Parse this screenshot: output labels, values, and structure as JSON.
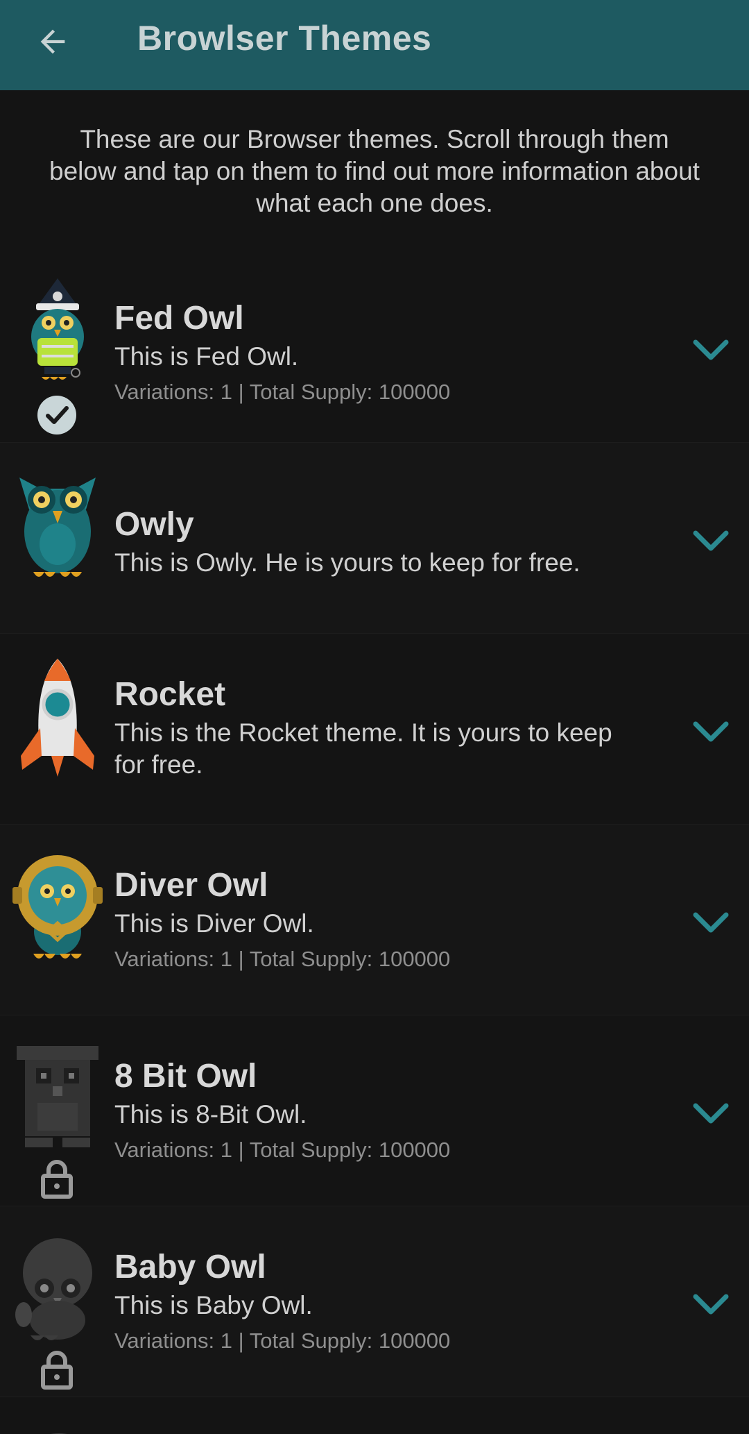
{
  "appbar": {
    "title": "Browlser Themes",
    "back_icon": "arrow-left-icon"
  },
  "intro": "These are our Browser themes. Scroll through them below and tap on them to find out more information about what each one does.",
  "colors": {
    "appbar": "#1e5a61",
    "accent": "#2b8a91",
    "background": "#141414"
  },
  "themes": [
    {
      "name": "Fed Owl",
      "description": "This is Fed Owl.",
      "meta": "Variations: 1 | Total Supply: 100000",
      "status": "selected"
    },
    {
      "name": "Owly",
      "description": "This is Owly. He is yours to keep for free.",
      "meta": "",
      "status": "none"
    },
    {
      "name": "Rocket",
      "description": "This is the Rocket theme. It is yours to keep for free.",
      "meta": "",
      "status": "none"
    },
    {
      "name": "Diver Owl",
      "description": "This is Diver Owl.",
      "meta": "Variations: 1 | Total Supply: 100000",
      "status": "none"
    },
    {
      "name": "8 Bit Owl",
      "description": "This is 8-Bit Owl.",
      "meta": "Variations: 1 | Total Supply: 100000",
      "status": "locked"
    },
    {
      "name": "Baby Owl",
      "description": "This is Baby Owl.",
      "meta": "Variations: 1 | Total Supply: 100000",
      "status": "locked"
    }
  ]
}
